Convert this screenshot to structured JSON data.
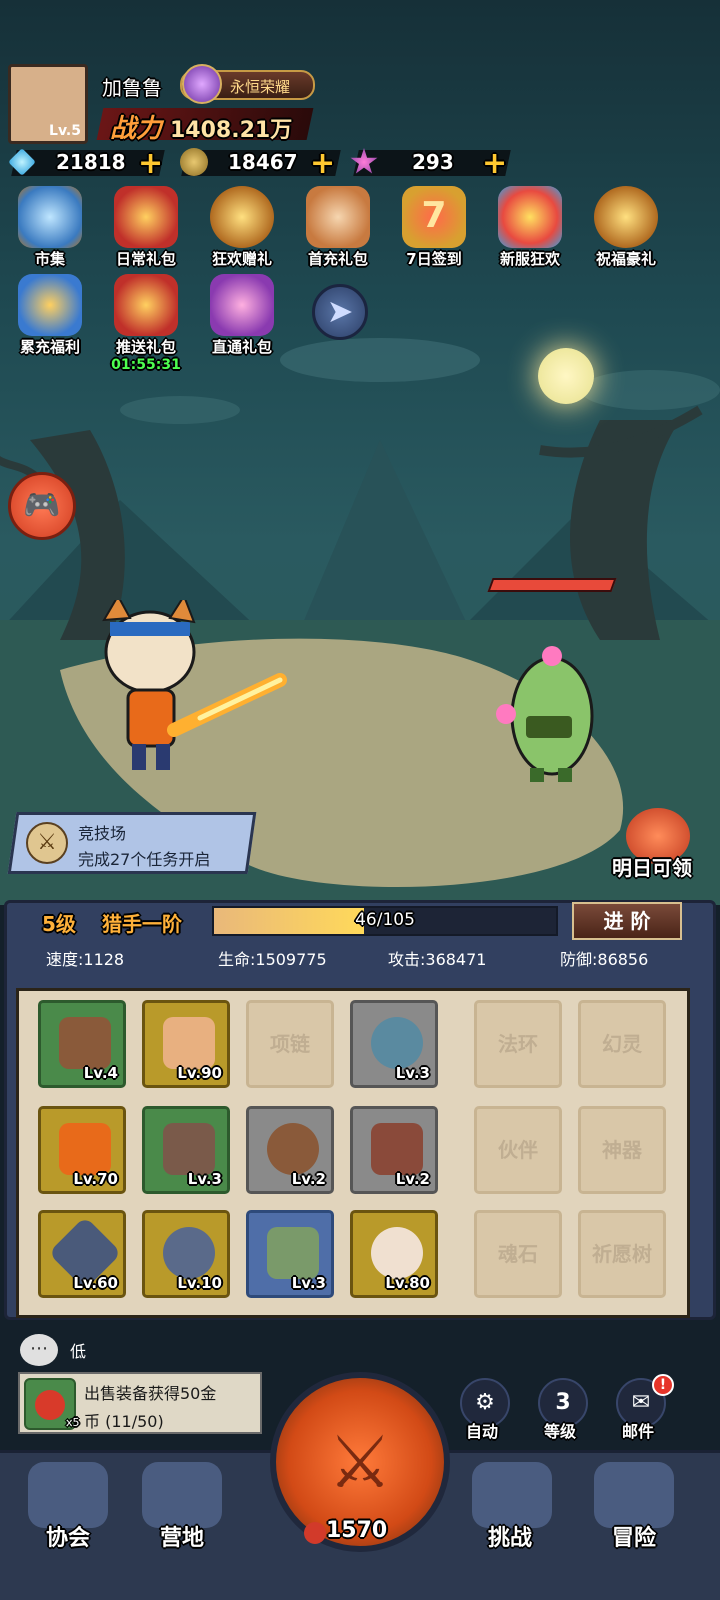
{
  "player": {
    "name": "加鲁鲁",
    "level": "Lv.5",
    "honor": "永恒荣耀",
    "power_label": "战力",
    "power_value": "1408.21万"
  },
  "resources": {
    "gems": "21818",
    "gold": "18467",
    "stars": "293",
    "plus": "+"
  },
  "events": [
    {
      "label": "市集"
    },
    {
      "label": "日常礼包"
    },
    {
      "label": "狂欢赠礼"
    },
    {
      "label": "首充礼包"
    },
    {
      "label": "7日签到"
    },
    {
      "label": "新服狂欢"
    },
    {
      "label": "祝福豪礼"
    },
    {
      "label": "累充福利"
    },
    {
      "label": "推送礼包",
      "timer": "01:55:31"
    },
    {
      "label": "直通礼包"
    }
  ],
  "arena": {
    "title": "竞技场",
    "desc": "完成27个任务开启"
  },
  "tomorrow": "明日可领",
  "hero": {
    "level": "5级",
    "rank": "猎手一阶",
    "xp": "46/105",
    "xp_fraction": 0.438,
    "advance": "进 阶"
  },
  "stats": {
    "speed": "速度:1128",
    "hp": "生命:1509775",
    "attack": "攻击:368471",
    "defense": "防御:86856"
  },
  "equipment": {
    "row1": [
      "Lv.4",
      "Lv.90",
      "项链",
      "Lv.3",
      "法环",
      "幻灵"
    ],
    "row2": [
      "Lv.70",
      "Lv.3",
      "Lv.2",
      "Lv.2",
      "伙伴",
      "神器"
    ],
    "row3": [
      "Lv.60",
      "Lv.10",
      "Lv.3",
      "Lv.80",
      "魂石",
      "祈愿树"
    ]
  },
  "chat": {
    "text": "低"
  },
  "quest": {
    "line1": "出售装备获得50金",
    "line2": "币 (11/50)",
    "count": "x5"
  },
  "actions": {
    "auto": "自动",
    "level_num": "3",
    "level": "等级",
    "mail": "邮件",
    "mail_badge": "!"
  },
  "nav": {
    "guild": "协会",
    "camp": "营地",
    "energy": "1570",
    "challenge": "挑战",
    "adventure": "冒险"
  }
}
